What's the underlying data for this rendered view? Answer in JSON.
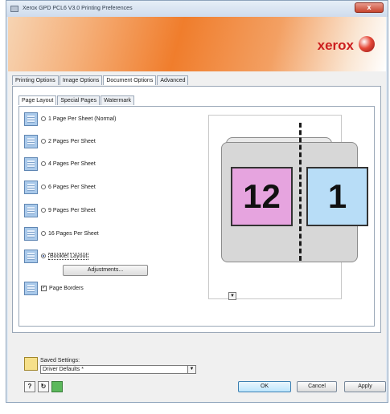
{
  "window": {
    "title": "Xerox GPD PCL6 V3.0 Printing Preferences",
    "close_glyph": "x"
  },
  "brand": {
    "name": "xerox"
  },
  "tabs": [
    {
      "label": "Printing Options"
    },
    {
      "label": "Image Options"
    },
    {
      "label": "Document Options",
      "active": true
    },
    {
      "label": "Advanced"
    }
  ],
  "subtabs": [
    {
      "label": "Page Layout",
      "active": true
    },
    {
      "label": "Special Pages"
    },
    {
      "label": "Watermark"
    }
  ],
  "layout_options": [
    {
      "label": "1 Page Per Sheet (Normal)",
      "selected": false
    },
    {
      "label": "2 Pages Per Sheet",
      "selected": false
    },
    {
      "label": "4 Pages Per Sheet",
      "selected": false
    },
    {
      "label": "6 Pages Per Sheet",
      "selected": false
    },
    {
      "label": "9 Pages Per Sheet",
      "selected": false
    },
    {
      "label": "16 Pages Per Sheet",
      "selected": false
    },
    {
      "label": "Booklet Layout",
      "selected": true
    }
  ],
  "adjustments_label": "Adjustments...",
  "page_borders": {
    "label": "Page Borders",
    "checked": true,
    "check_glyph": "✓"
  },
  "preview": {
    "left_page": "12",
    "right_page": "1",
    "left_color": "#e6a4df",
    "right_color": "#b8ddf7"
  },
  "saved_settings": {
    "label": "Saved Settings:",
    "value": "Driver Defaults *"
  },
  "footer": {
    "help_glyph": "?",
    "reset_glyph": "↻",
    "ok": "OK",
    "cancel": "Cancel",
    "apply": "Apply"
  },
  "icons": {
    "dropdown": "▼"
  },
  "colors": {
    "brand_red": "#cc1f1f",
    "banner_orange": "#f07d2c"
  }
}
